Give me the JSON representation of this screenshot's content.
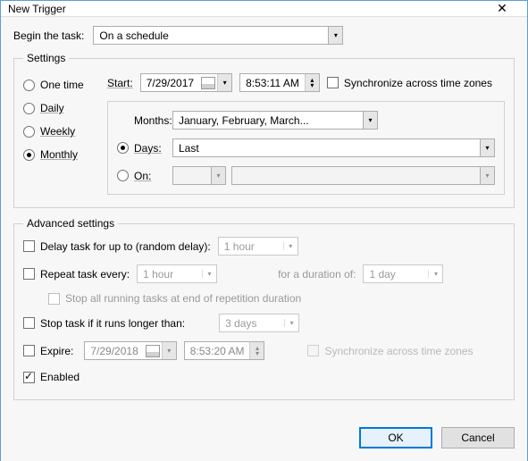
{
  "window": {
    "title": "New Trigger"
  },
  "begin": {
    "label": "Begin the task:",
    "value": "On a schedule"
  },
  "settings": {
    "legend": "Settings",
    "freq": {
      "one_time": "One time",
      "daily": "Daily",
      "weekly": "Weekly",
      "monthly": "Monthly"
    },
    "start_label": "Start:",
    "start_date": "7/29/2017",
    "start_time": "8:53:11 AM",
    "sync_label": "Synchronize across time zones",
    "months_label": "Months:",
    "months_value": "January, February, March...",
    "days_label": "Days:",
    "days_value": "Last",
    "on_label": "On:"
  },
  "advanced": {
    "legend": "Advanced settings",
    "delay_label": "Delay task for up to (random delay):",
    "delay_value": "1 hour",
    "repeat_label": "Repeat task every:",
    "repeat_value": "1 hour",
    "duration_label": "for a duration of:",
    "duration_value": "1 day",
    "stop_all_label": "Stop all running tasks at end of repetition duration",
    "stop_if_label": "Stop task if it runs longer than:",
    "stop_if_value": "3 days",
    "expire_label": "Expire:",
    "expire_date": "7/29/2018",
    "expire_time": "8:53:20 AM",
    "sync2_label": "Synchronize across time zones",
    "enabled_label": "Enabled"
  },
  "buttons": {
    "ok": "OK",
    "cancel": "Cancel"
  }
}
